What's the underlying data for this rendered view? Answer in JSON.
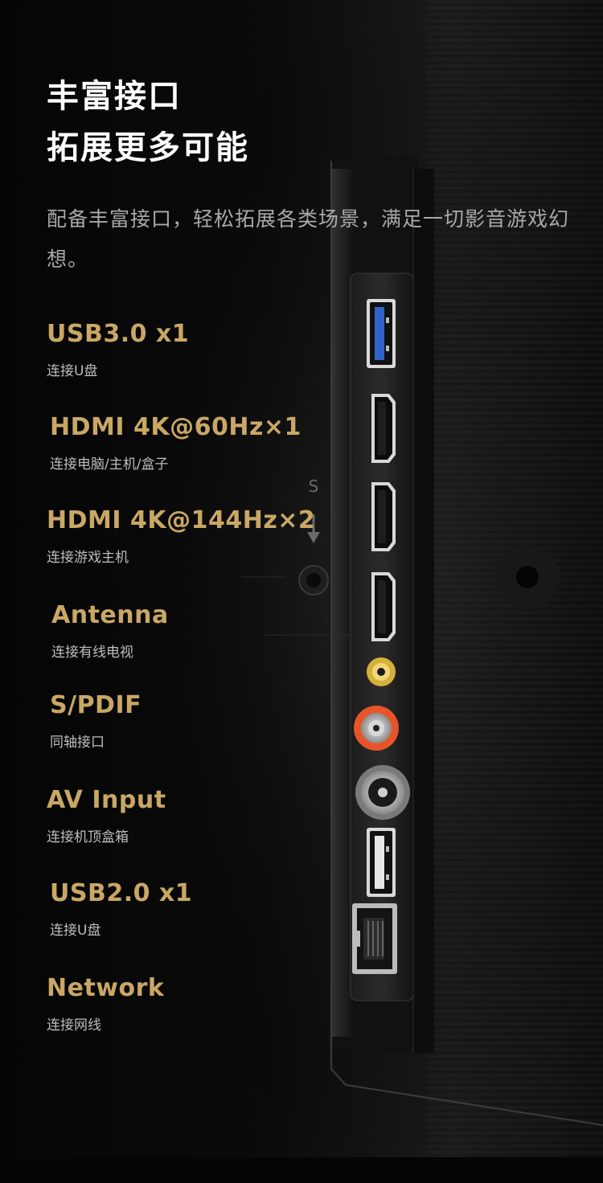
{
  "headline": {
    "line1": "丰富接口",
    "line2": "拓展更多可能"
  },
  "description": "配备丰富接口，轻松拓展各类场景，满足一切影音游戏幻想。",
  "ports": [
    {
      "name": "USB3.0 x1",
      "desc": "连接U盘"
    },
    {
      "name": "HDMI 4K@60Hz×1",
      "desc": "连接电脑/主机/盒子"
    },
    {
      "name": "HDMI 4K@144Hz×2",
      "desc": "连接游戏主机"
    },
    {
      "name": "Antenna",
      "desc": "连接有线电视"
    },
    {
      "name": "S/PDIF",
      "desc": "同轴接口"
    },
    {
      "name": "AV Input",
      "desc": "连接机顶盒箱"
    },
    {
      "name": "USB2.0 x1",
      "desc": "连接U盘"
    },
    {
      "name": "Network",
      "desc": "连接网线"
    }
  ],
  "device_markings": {
    "button_label": "S"
  },
  "colors": {
    "accent_gold": "#c9a764",
    "usb3_blue": "#2f64c8",
    "spdif_gold": "#d4b23a",
    "av_orange": "#e8542a"
  },
  "icons": [
    "usb3-port-icon",
    "hdmi-port-icon",
    "spdif-port-icon",
    "av-port-icon",
    "antenna-port-icon",
    "usb2-port-icon",
    "ethernet-port-icon",
    "power-button-icon",
    "arrow-down-icon"
  ]
}
